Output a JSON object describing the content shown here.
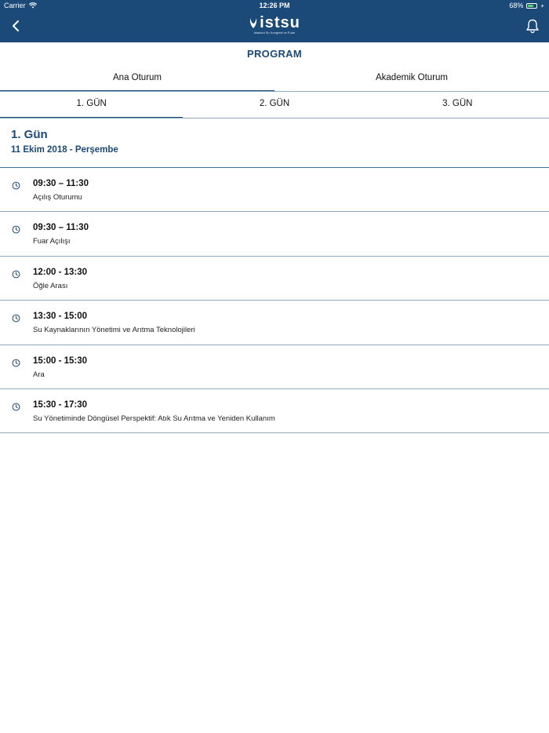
{
  "status_bar": {
    "carrier": "Carrier",
    "time": "12:26 PM",
    "battery": "68%",
    "battery_level": 0.68
  },
  "nav": {
    "back_icon": "chevron-left-icon",
    "logo_text": "istsu",
    "logo_subtitle": "İstanbul Su Kongresi ve Fuarı",
    "bell_icon": "bell-icon"
  },
  "page": {
    "title": "PROGRAM"
  },
  "session_tabs": [
    {
      "label": "Ana Oturum",
      "active": true
    },
    {
      "label": "Akademik Oturum",
      "active": false
    }
  ],
  "day_tabs": [
    {
      "label": "1. GÜN",
      "active": true
    },
    {
      "label": "2. GÜN",
      "active": false
    },
    {
      "label": "3. GÜN",
      "active": false
    }
  ],
  "day": {
    "title": "1. Gün",
    "date": "11 Ekim 2018 - Perşembe"
  },
  "schedule": [
    {
      "time": "09:30 – 11:30",
      "label": "Açılış Oturumu"
    },
    {
      "time": "09:30 – 11:30",
      "label": "Fuar Açılışı"
    },
    {
      "time": "12:00 - 13:30",
      "label": "Öğle Arası"
    },
    {
      "time": "13:30 - 15:00",
      "label": "Su Kaynaklarının Yönetimi ve Arıtma Teknolojileri"
    },
    {
      "time": "15:00 - 15:30",
      "label": "Ara"
    },
    {
      "time": "15:30 - 17:30",
      "label": "Su Yönetiminde Döngüsel Perspektif: Atık Su Arıtma ve Yeniden Kullanım"
    }
  ],
  "colors": {
    "brand": "#1b4a78",
    "divider": "#8fa8c2"
  }
}
